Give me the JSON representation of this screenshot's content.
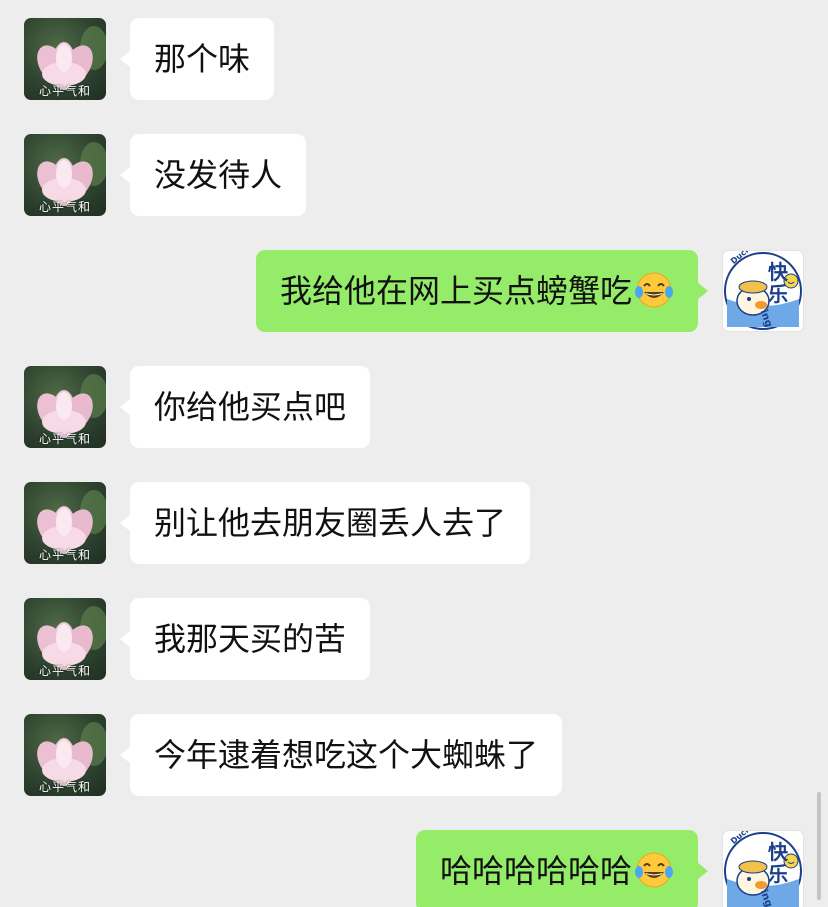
{
  "contacts": {
    "friend": {
      "avatar_label": "心平气和",
      "avatar_icon": "lotus-flower"
    },
    "self": {
      "avatar_chars": "快乐",
      "avatar_brand": "DuckDuck",
      "avatar_ing": "ing",
      "avatar_icon": "duck-cartoon"
    }
  },
  "messages": [
    {
      "side": "left",
      "text": "那个味"
    },
    {
      "side": "left",
      "text": "没发待人"
    },
    {
      "side": "right",
      "text": "我给他在网上买点螃蟹吃",
      "emoji": "tears-of-joy"
    },
    {
      "side": "left",
      "text": "你给他买点吧"
    },
    {
      "side": "left",
      "text": "别让他去朋友圈丢人去了"
    },
    {
      "side": "left",
      "text": "我那天买的苦"
    },
    {
      "side": "left",
      "text": "今年逮着想吃这个大蜘蛛了"
    },
    {
      "side": "right",
      "text": "哈哈哈哈哈哈",
      "emoji": "tears-of-joy"
    }
  ],
  "colors": {
    "background": "#ededed",
    "incoming_bubble": "#ffffff",
    "outgoing_bubble": "#95ec69",
    "text": "#111111"
  }
}
